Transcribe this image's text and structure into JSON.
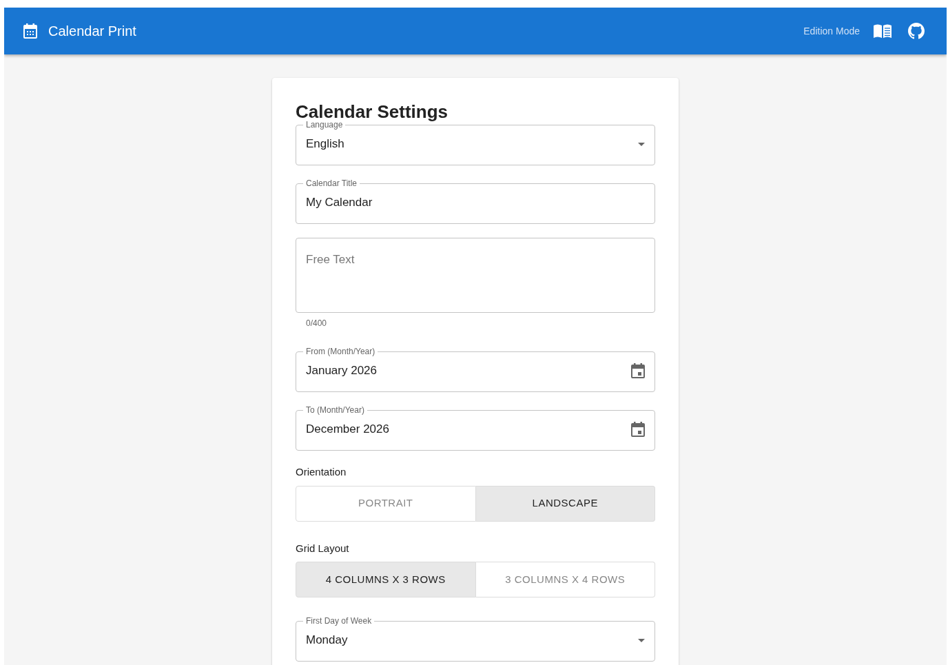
{
  "app_bar": {
    "title": "Calendar Print",
    "mode_label": "Edition Mode"
  },
  "settings": {
    "heading": "Calendar Settings",
    "fields": [
      {
        "kind": "select",
        "label": "Language",
        "value": "English"
      },
      {
        "kind": "text",
        "label": "Calendar Title",
        "value": "My Calendar"
      },
      {
        "kind": "textarea",
        "placeholder": "Free Text",
        "counter": "0/400"
      },
      {
        "kind": "date",
        "label": "From (Month/Year)",
        "value": "January 2026"
      },
      {
        "kind": "date",
        "label": "To (Month/Year)",
        "value": "December 2026"
      },
      {
        "kind": "toggle",
        "label": "Orientation",
        "options": [
          {
            "label": "PORTRAIT",
            "selected": false
          },
          {
            "label": "LANDSCAPE",
            "selected": true
          }
        ]
      },
      {
        "kind": "toggle",
        "label": "Grid Layout",
        "options": [
          {
            "label": "4 COLUMNS X 3 ROWS",
            "selected": true
          },
          {
            "label": "3 COLUMNS X 4 ROWS",
            "selected": false
          }
        ]
      },
      {
        "kind": "select",
        "label": "First Day of Week",
        "value": "Monday"
      }
    ]
  }
}
